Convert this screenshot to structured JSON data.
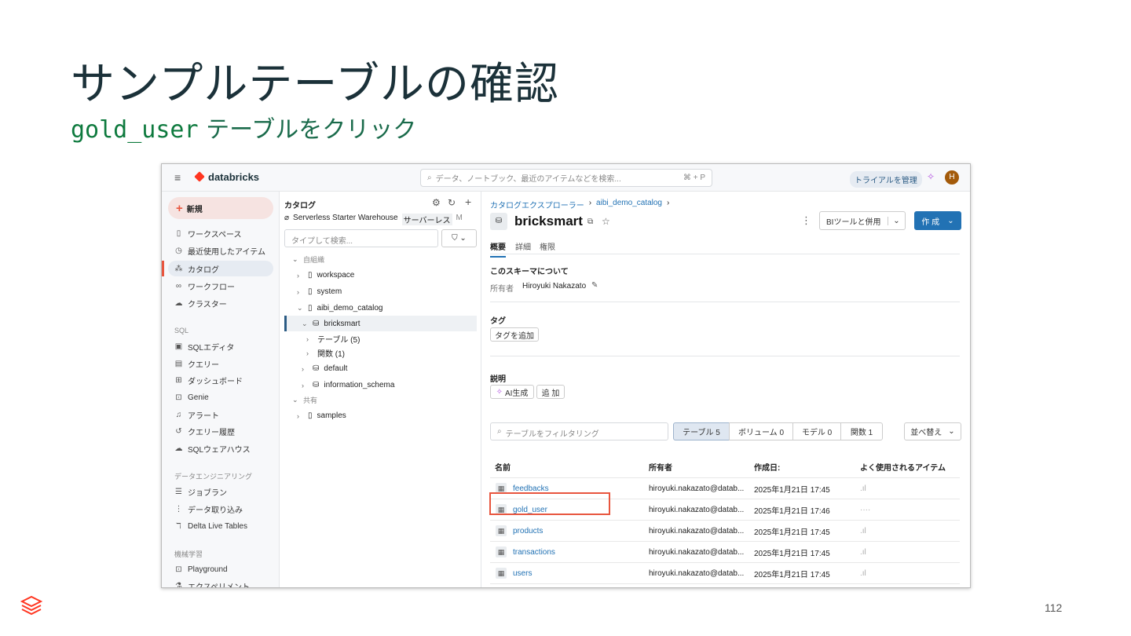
{
  "slide": {
    "title": "サンプルテーブルの確認",
    "subtitle_code": "gold_user",
    "subtitle_text": " テーブルをクリック",
    "page_number": "112"
  },
  "topbar": {
    "brand": "databricks",
    "search_placeholder": "データ、ノートブック、最近のアイテムなどを検索...",
    "shortcut": "⌘ + P",
    "trial": "トライアルを管理",
    "avatar": "H"
  },
  "sidebar": {
    "new": "新規",
    "items": [
      "ワークスペース",
      "最近使用したアイテム",
      "カタログ",
      "ワークフロー",
      "クラスター"
    ],
    "sql_section": "SQL",
    "sql_items": [
      "SQLエディタ",
      "クエリー",
      "ダッシュボード",
      "Genie",
      "アラート",
      "クエリー履歴",
      "SQLウェアハウス"
    ],
    "de_section": "データエンジニアリング",
    "de_items": [
      "ジョブラン",
      "データ取り込み",
      "Delta Live Tables"
    ],
    "ml_section": "機械学習",
    "ml_items": [
      "Playground",
      "エクスペリメント"
    ]
  },
  "catalog": {
    "title": "カタログ",
    "warehouse": "Serverless Starter Warehouse",
    "warehouse_badge": "サーバーレス",
    "warehouse_size": "M",
    "search_placeholder": "タイプして検索...",
    "my_org": "自組織",
    "nodes": [
      "workspace",
      "system",
      "aibi_demo_catalog",
      "bricksmart",
      "テーブル (5)",
      "関数 (1)",
      "default",
      "information_schema"
    ],
    "shared": "共有",
    "shared_nodes": [
      "samples"
    ]
  },
  "main": {
    "breadcrumb": [
      "カタログエクスプローラー",
      "aibi_demo_catalog"
    ],
    "schema_name": "bricksmart",
    "bi_button": "BIツールと併用",
    "create_button": "作 成",
    "tabs": [
      "概要",
      "詳細",
      "権限"
    ],
    "about_heading": "このスキーマについて",
    "owner_label": "所有者",
    "owner": "Hiroyuki Nakazato",
    "tags_heading": "タグ",
    "add_tag": "タグを追加",
    "desc_heading": "説明",
    "ai_generate": "AI生成",
    "add": "追 加",
    "filter_placeholder": "テーブルをフィルタリング",
    "segments": [
      "テーブル 5",
      "ボリューム 0",
      "モデル 0",
      "関数 1"
    ],
    "sort": "並べ替え",
    "columns": [
      "名前",
      "所有者",
      "作成日:",
      "よく使用されるアイテム"
    ],
    "rows": [
      {
        "name": "feedbacks",
        "owner": "hiroyuki.nakazato@datab...",
        "created": "2025年1月21日 17:45",
        "usage": ".ıl"
      },
      {
        "name": "gold_user",
        "owner": "hiroyuki.nakazato@datab...",
        "created": "2025年1月21日 17:46",
        "usage": "····"
      },
      {
        "name": "products",
        "owner": "hiroyuki.nakazato@datab...",
        "created": "2025年1月21日 17:45",
        "usage": ".ıl"
      },
      {
        "name": "transactions",
        "owner": "hiroyuki.nakazato@datab...",
        "created": "2025年1月21日 17:45",
        "usage": ".ıl"
      },
      {
        "name": "users",
        "owner": "hiroyuki.nakazato@datab...",
        "created": "2025年1月21日 17:45",
        "usage": ".ıl"
      }
    ]
  },
  "colors": {
    "accent": "#2272b4",
    "highlight": "#e8553e",
    "brand": "#ff3621"
  }
}
